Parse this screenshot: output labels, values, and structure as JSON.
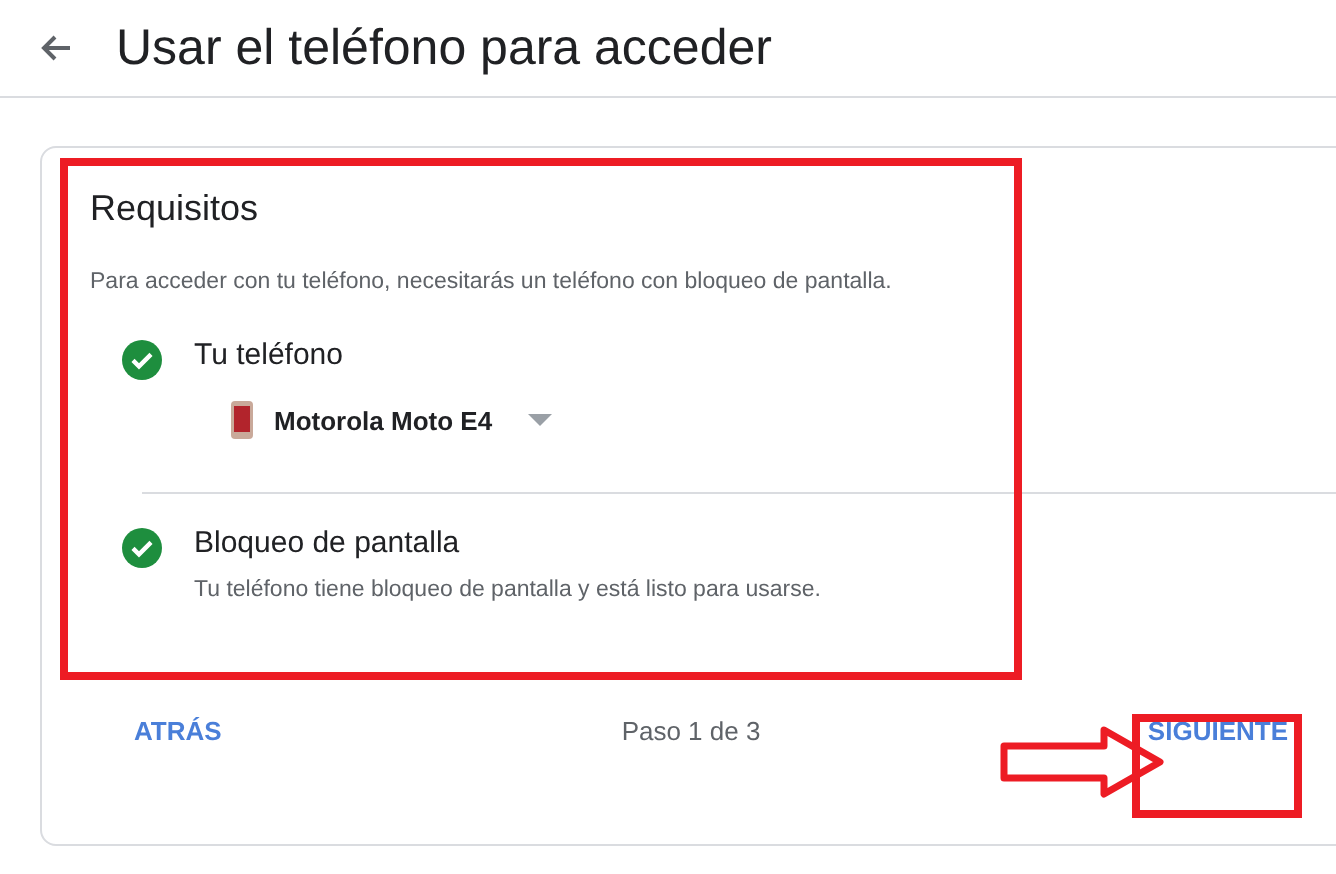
{
  "header": {
    "title": "Usar el teléfono para acceder"
  },
  "card": {
    "title": "Requisitos",
    "description": "Para acceder con tu teléfono, necesitarás un teléfono con bloqueo de pantalla.",
    "requirements": [
      {
        "label": "Tu teléfono",
        "done": true,
        "device": {
          "name": "Motorola Moto E4"
        }
      },
      {
        "label": "Bloqueo de pantalla",
        "done": true,
        "detail": "Tu teléfono tiene bloqueo de pantalla y está listo para usarse."
      }
    ]
  },
  "footer": {
    "back": "ATRÁS",
    "step": "Paso 1 de 3",
    "next": "SIGUIENTE"
  },
  "annotations": [
    {
      "kind": "frame"
    },
    {
      "kind": "frame"
    },
    {
      "kind": "arrow"
    }
  ]
}
